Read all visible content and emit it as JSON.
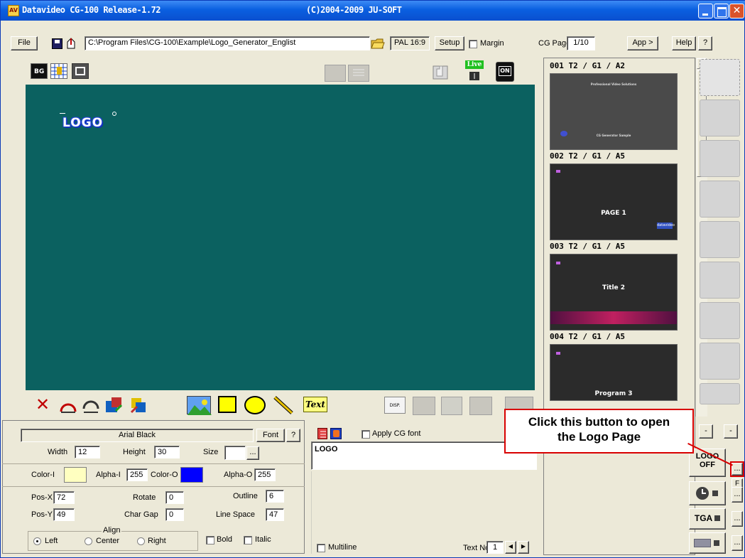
{
  "window": {
    "app_icon": "AV",
    "title_left": "Datavideo CG-100  Release-1.72",
    "title_right": "(C)2004-2009  JU-SOFT"
  },
  "toolbar": {
    "file_label": "File",
    "path_value": "C:\\Program Files\\CG-100\\Example\\Logo_Generator_Englist",
    "format_label": "PAL 16:9",
    "setup_label": "Setup",
    "margin_label": "Margin",
    "cgpage_label": "CG Page",
    "cgpage_value": "1/10",
    "app_label": "App >",
    "help_label": "Help",
    "question_label": "?"
  },
  "icons": {
    "live_label": "Live",
    "on_label": "ON",
    "text_tool_label": "Text",
    "disp_label": "DISP."
  },
  "canvas": {
    "background": "#0b6160",
    "logo_text": "LOGO"
  },
  "pages": [
    {
      "head": "001   T2 / G1 / A2",
      "caption_top": "Professional Video Solutions",
      "caption_bottom": "CG Generator Sample"
    },
    {
      "head": "002   T2 / G1 / A5",
      "caption": "PAGE 1",
      "badge": "datavideo"
    },
    {
      "head": "003   T2 / G1 / A5",
      "caption": "Title 2"
    },
    {
      "head": "004   T2 / G1 / A5",
      "caption": "Program 3"
    }
  ],
  "right_buttons": {
    "logo_off_line1": "LOGO",
    "logo_off_line2": "OFF",
    "dots": "...",
    "f_label": "F",
    "minus": "-",
    "tga_label": "TGA"
  },
  "callout": {
    "text_line1": "Click this button to open",
    "text_line2": "the Logo Page",
    "color": "#d80000"
  },
  "props": {
    "font_name": "Arial Black",
    "font_button": "Font",
    "question": "?",
    "width_label": "Width",
    "width_value": "12",
    "height_label": "Height",
    "height_value": "30",
    "size_label": "Size",
    "size_button": "...",
    "color_i_label": "Color-I",
    "color_i_value": "#ffffc0",
    "alpha_i_label": "Alpha-I",
    "alpha_i_value": "255",
    "color_o_label": "Color-O",
    "color_o_value": "#0000ff",
    "alpha_o_label": "Alpha-O",
    "alpha_o_value": "255",
    "posx_label": "Pos-X",
    "posx_value": "72",
    "posy_label": "Pos-Y",
    "posy_value": "49",
    "rotate_label": "Rotate",
    "rotate_value": "0",
    "chargap_label": "Char Gap",
    "chargap_value": "0",
    "outline_label": "Outline",
    "outline_value": "6",
    "linespace_label": "Line Space",
    "linespace_value": "47",
    "align_label": "Align",
    "left_label": "Left",
    "center_label": "Center",
    "right_label": "Right",
    "bold_label": "Bold",
    "italic_label": "Italic"
  },
  "textpanel": {
    "apply_font_label": "Apply CG font",
    "text_value": "LOGO",
    "multiline_label": "Multiline",
    "textno_label": "Text No.",
    "textno_value": "1"
  }
}
